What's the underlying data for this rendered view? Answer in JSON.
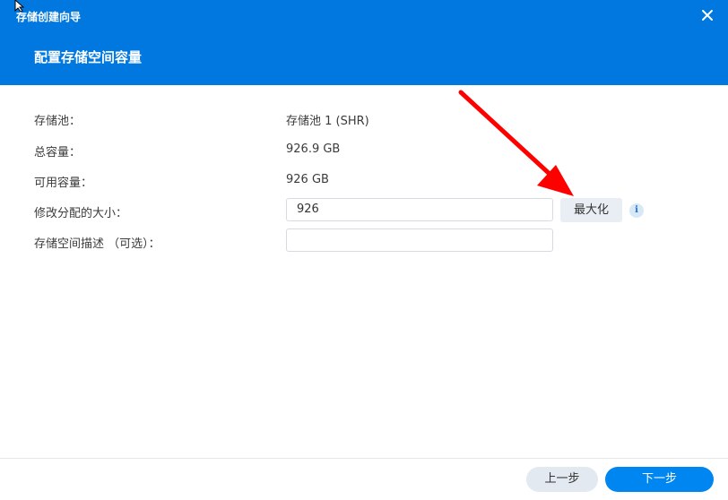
{
  "window": {
    "title": "存储创建向导",
    "close_icon": "close-icon"
  },
  "page": {
    "subtitle": "配置存储空间容量"
  },
  "form": {
    "rows": [
      {
        "label": "存储池：",
        "value": "存储池 1 (SHR)"
      },
      {
        "label": "总容量：",
        "value": "926.9 GB"
      },
      {
        "label": "可用容量：",
        "value": "926 GB"
      }
    ],
    "size_label": "修改分配的大小：",
    "size_value": "926",
    "max_button": "最大化",
    "info_icon_glyph": "i",
    "desc_label": "存储空间描述 （可选）：",
    "desc_value": ""
  },
  "footer": {
    "prev_button": "上一步",
    "next_button": "下一步"
  },
  "colors": {
    "header": "#0078e0",
    "primary_button": "#0086f0",
    "annotation_arrow": "#ff0000"
  }
}
